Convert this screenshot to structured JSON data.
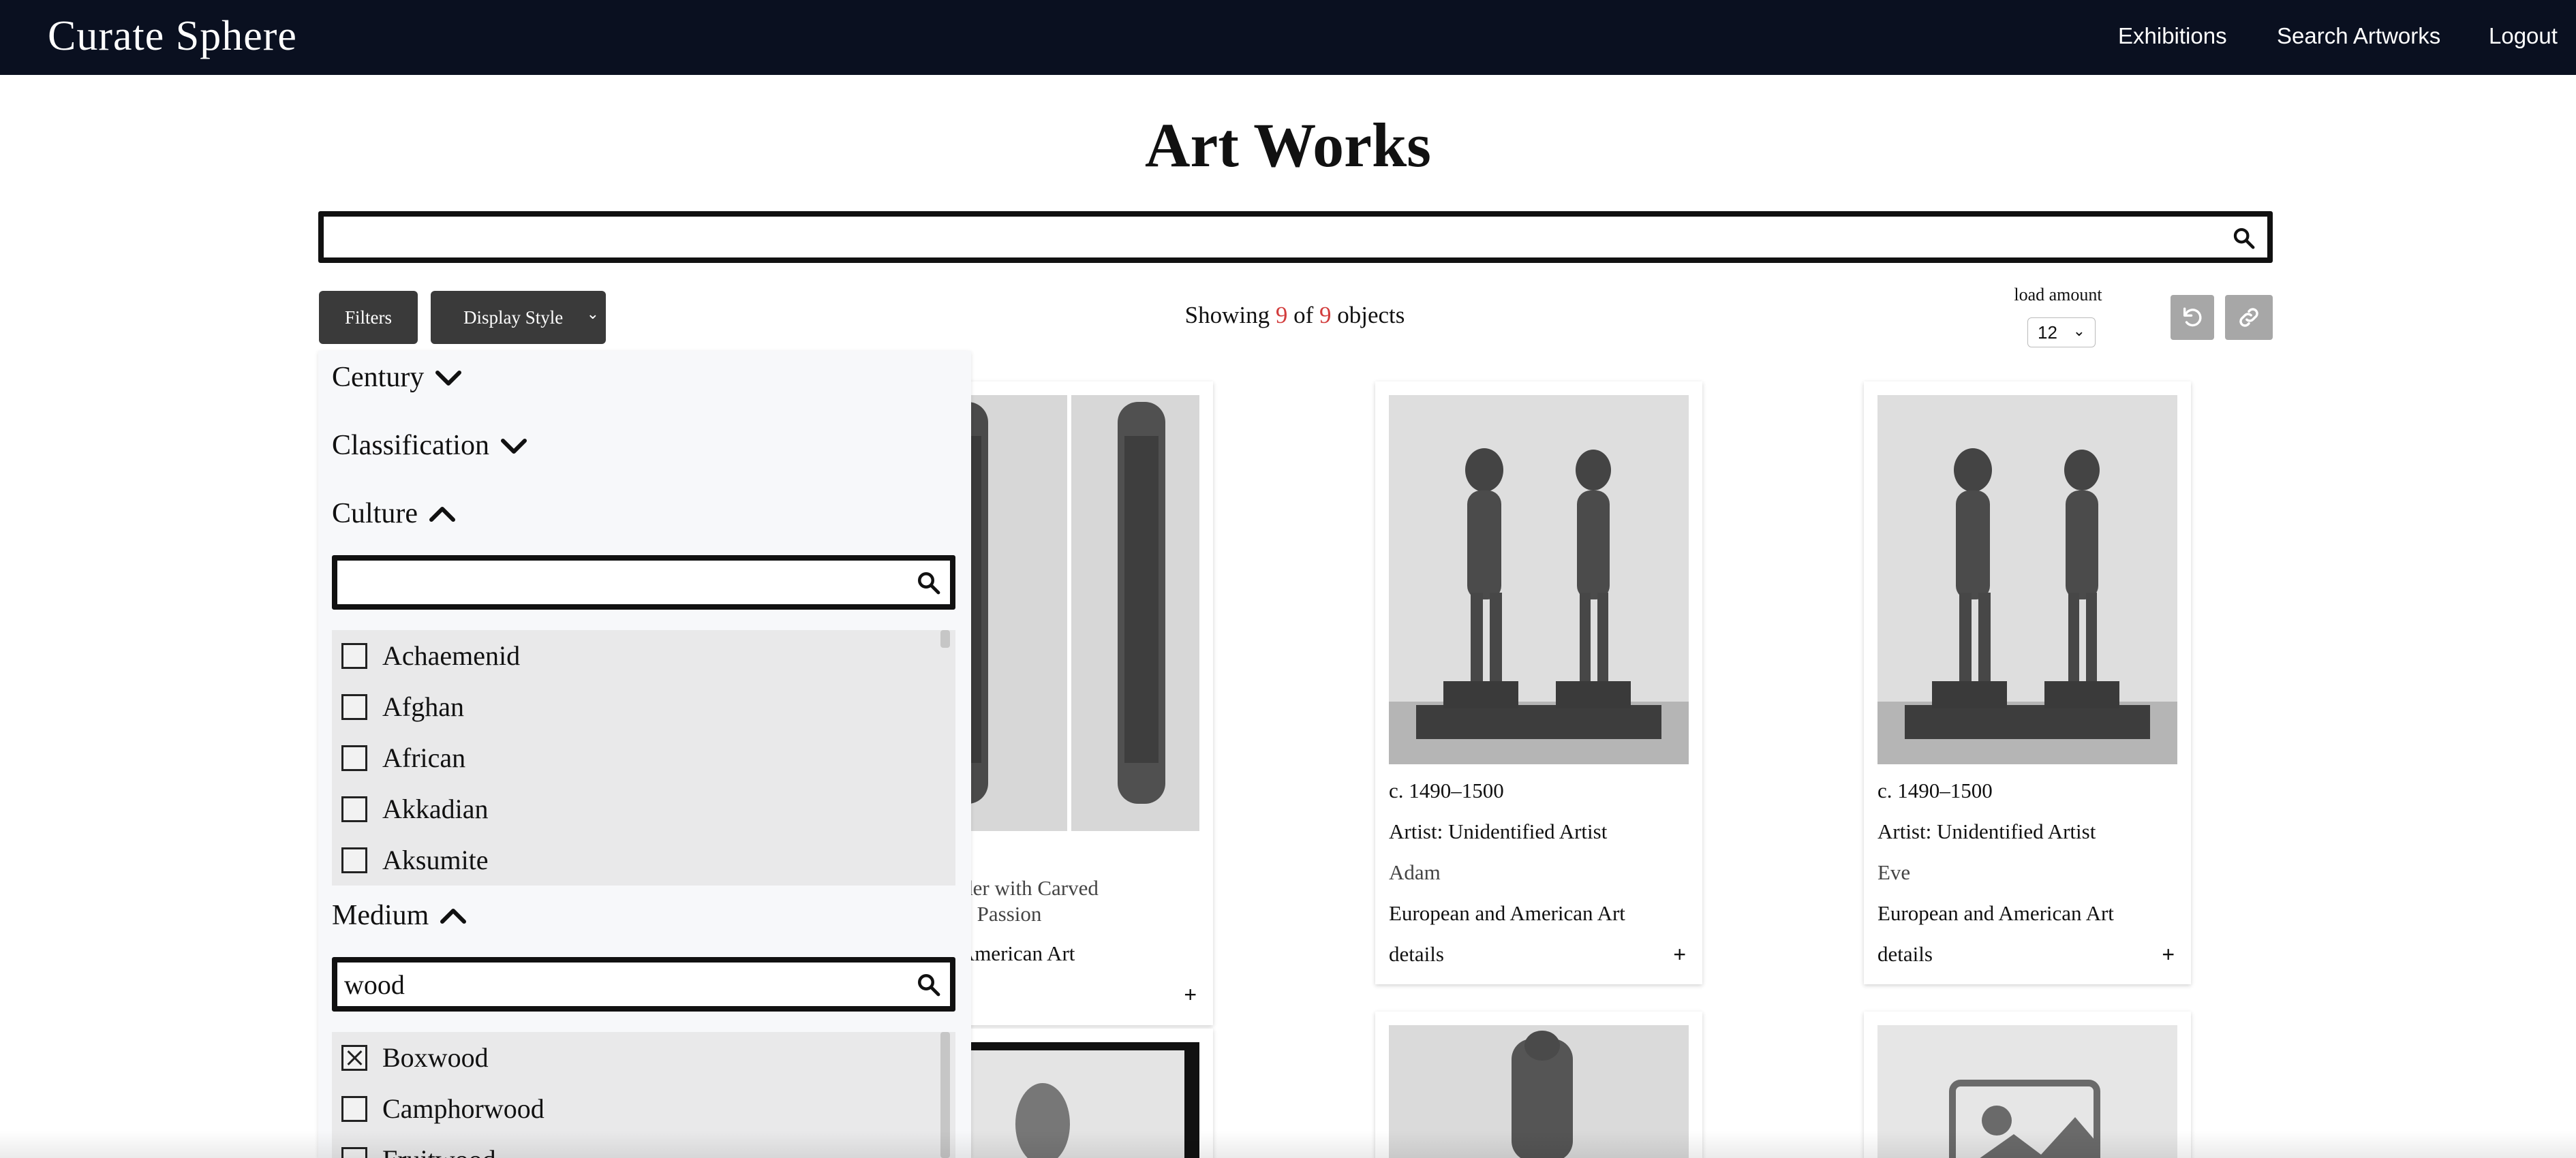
{
  "app": {
    "brand": "Curate Sphere"
  },
  "nav": {
    "exhibitions": "Exhibitions",
    "search_artworks": "Search Artworks",
    "logout": "Logout"
  },
  "page": {
    "title": "Art Works"
  },
  "search": {
    "value": "",
    "placeholder": ""
  },
  "toolbar": {
    "filters_label": "Filters",
    "display_style_label": "Display Style",
    "showing_prefix": "Showing",
    "showing_count": "9",
    "showing_of": "of",
    "showing_total": "9",
    "showing_suffix": "objects",
    "load_amount_label": "load amount",
    "load_amount_value": "12",
    "accent_color": "#d23c3c"
  },
  "filters": {
    "century": {
      "label": "Century",
      "state": "collapsed"
    },
    "classification": {
      "label": "Classification",
      "state": "collapsed"
    },
    "culture": {
      "label": "Culture",
      "state": "expanded",
      "search_value": "",
      "options": [
        {
          "label": "Achaemenid",
          "checked": false
        },
        {
          "label": "Afghan",
          "checked": false
        },
        {
          "label": "African",
          "checked": false
        },
        {
          "label": "Akkadian",
          "checked": false
        },
        {
          "label": "Aksumite",
          "checked": false
        }
      ]
    },
    "medium": {
      "label": "Medium",
      "state": "expanded",
      "search_value": "wood",
      "options": [
        {
          "label": "Boxwood",
          "checked": true
        },
        {
          "label": "Camphorwood",
          "checked": false
        },
        {
          "label": "Fruitwood",
          "checked": false
        }
      ]
    }
  },
  "cards": [
    {
      "date": "",
      "artist": "",
      "title": "ent Holder with Carved\nfrom the Passion",
      "department": "an and American Art",
      "details": "",
      "expand": "+"
    },
    {
      "date": "c. 1490–1500",
      "artist": "Artist: Unidentified Artist",
      "title": "Adam",
      "department": "European and American Art",
      "details": "details",
      "expand": "+"
    },
    {
      "date": "c. 1490–1500",
      "artist": "Artist: Unidentified Artist",
      "title": "Eve",
      "department": "European and American Art",
      "details": "details",
      "expand": "+"
    }
  ]
}
